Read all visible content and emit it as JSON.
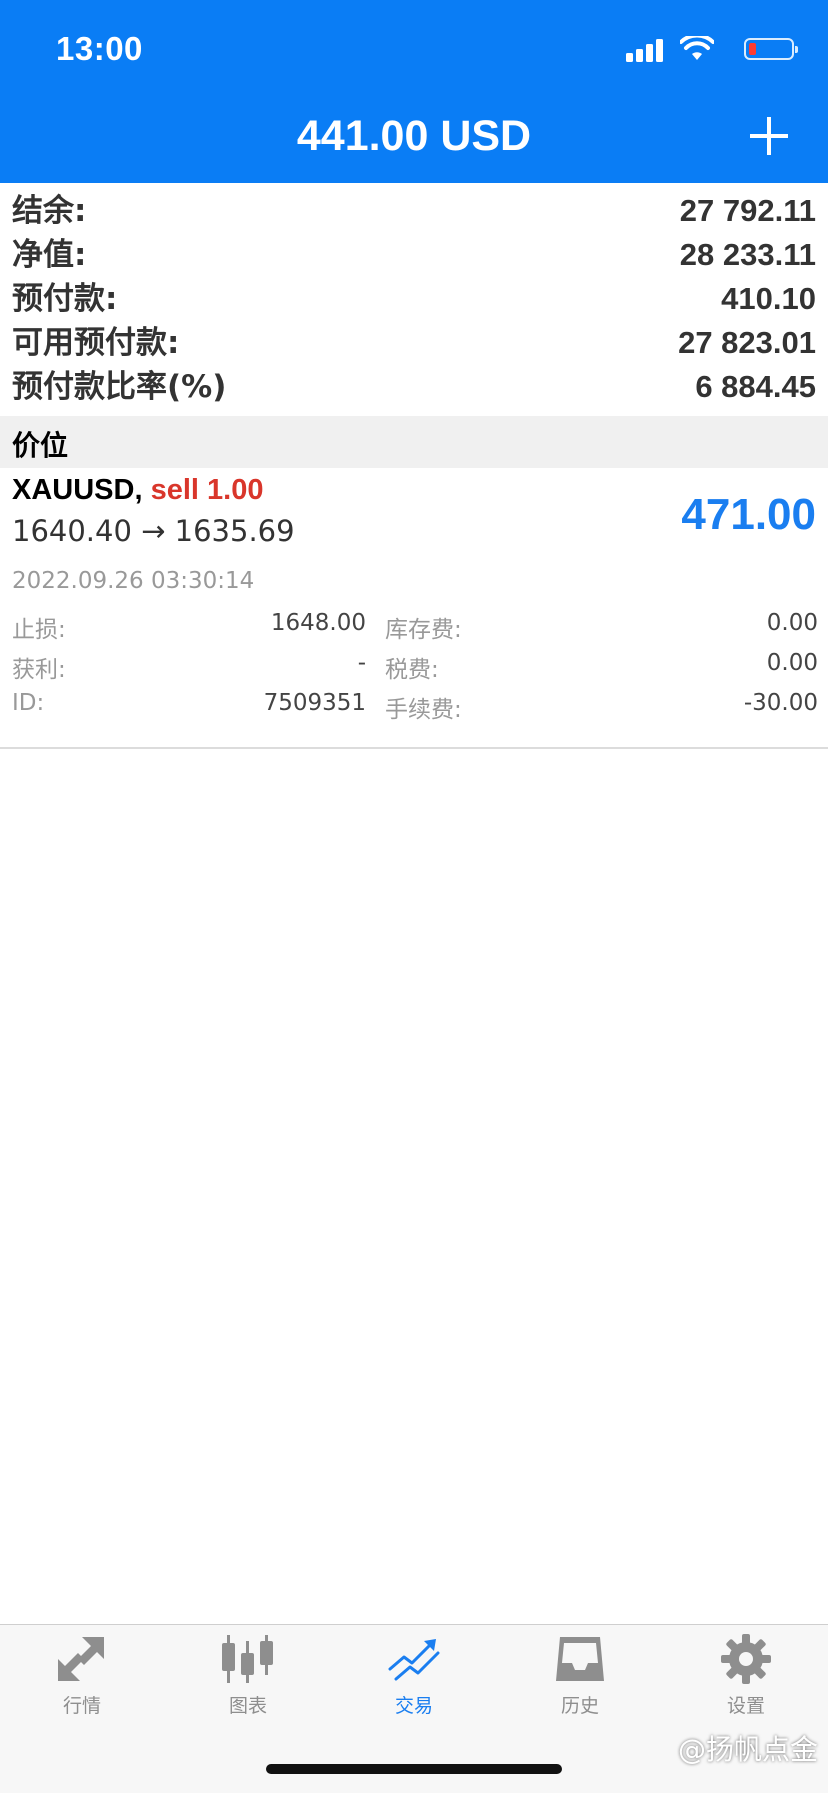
{
  "status_bar": {
    "time": "13:00"
  },
  "header": {
    "title": "441.00 USD"
  },
  "summary": [
    {
      "label": "结余:",
      "value": "27 792.11"
    },
    {
      "label": "净值:",
      "value": "28 233.11"
    },
    {
      "label": "预付款:",
      "value": "410.10"
    },
    {
      "label": "可用预付款:",
      "value": "27 823.01"
    },
    {
      "label": "预付款比率(%)",
      "value": "6 884.45"
    }
  ],
  "section": {
    "title": "价位"
  },
  "position": {
    "symbol": "XAUUSD,",
    "side": "sell 1.00",
    "prices": "1640.40 → 1635.69",
    "profit": "471.00",
    "time": "2022.09.26 03:30:14",
    "details": [
      {
        "label1": "止损:",
        "value1": "1648.00",
        "label2": "库存费:",
        "value2": "0.00"
      },
      {
        "label1": "获利:",
        "value1": "-",
        "label2": "税费:",
        "value2": "0.00"
      },
      {
        "label1": "ID:",
        "value1": "7509351",
        "label2": "手续费:",
        "value2": "-30.00"
      }
    ]
  },
  "tabs": [
    {
      "label": "行情",
      "icon": "quotes-arrows-icon",
      "active": false
    },
    {
      "label": "图表",
      "icon": "candlestick-chart-icon",
      "active": false
    },
    {
      "label": "交易",
      "icon": "trade-trend-icon",
      "active": true
    },
    {
      "label": "历史",
      "icon": "history-inbox-icon",
      "active": false
    },
    {
      "label": "设置",
      "icon": "gear-icon",
      "active": false
    }
  ],
  "watermark": "@扬帆点金",
  "colors": {
    "header_bg": "#0a7df5",
    "profit": "#1a7ef0",
    "sell": "#d9362b",
    "tab_active": "#1a7ef0",
    "tab_inactive": "#8e8e8e"
  }
}
